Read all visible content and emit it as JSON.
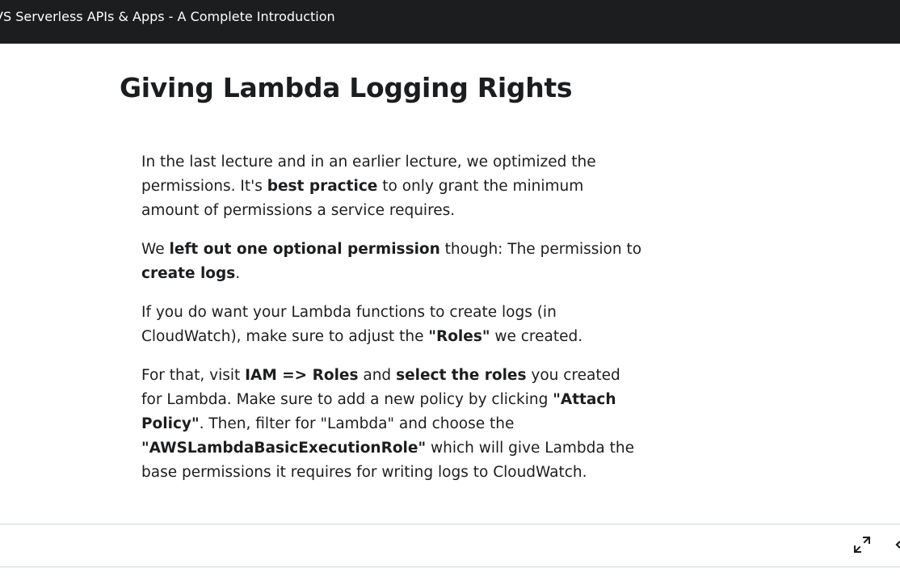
{
  "header": {
    "course_title": "VS Serverless APIs & Apps - A Complete Introduction"
  },
  "lecture": {
    "title": "Giving Lambda Logging Rights",
    "paragraphs": [
      [
        {
          "t": "In the last lecture and in an earlier lecture, we optimized the permissions. It's ",
          "b": false
        },
        {
          "t": "best practice",
          "b": true
        },
        {
          "t": " to only grant the minimum amount of permissions a service requires.",
          "b": false
        }
      ],
      [
        {
          "t": "We ",
          "b": false
        },
        {
          "t": "left out one optional permission",
          "b": true
        },
        {
          "t": " though: The permission to ",
          "b": false
        },
        {
          "t": "create logs",
          "b": true
        },
        {
          "t": ".",
          "b": false
        }
      ],
      [
        {
          "t": "If you do want your Lambda functions to create logs (in CloudWatch), make sure to adjust the ",
          "b": false
        },
        {
          "t": "\"Roles\"",
          "b": true
        },
        {
          "t": " we created.",
          "b": false
        }
      ],
      [
        {
          "t": "For that, visit ",
          "b": false
        },
        {
          "t": "IAM => Roles",
          "b": true
        },
        {
          "t": " and ",
          "b": false
        },
        {
          "t": "select the roles",
          "b": true
        },
        {
          "t": " you created for Lambda. Make sure to add a new policy by clicking ",
          "b": false
        },
        {
          "t": "\"Attach Policy\"",
          "b": true
        },
        {
          "t": ". Then, filter for \"Lambda\" and choose the ",
          "b": false
        },
        {
          "t": "\"AWSLambdaBasicExecutionRole\"",
          "b": true
        },
        {
          "t": " which will give Lambda the base permissions it requires for writing logs to CloudWatch.",
          "b": false
        }
      ]
    ]
  },
  "footer": {
    "fullscreen_icon": "expand-icon",
    "edge_icon": "chevron-left-icon"
  }
}
